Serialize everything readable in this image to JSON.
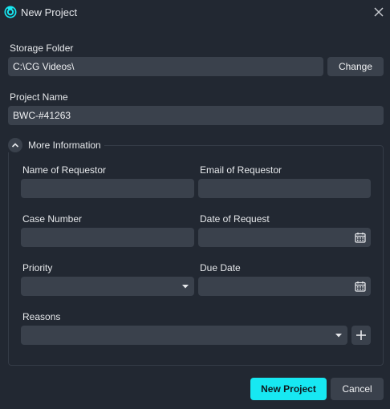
{
  "window": {
    "title": "New Project",
    "accent_color": "#17e8f2",
    "background_color": "#222832",
    "field_color": "#3a414c"
  },
  "storage": {
    "label": "Storage Folder",
    "value": "C:\\CG Videos\\",
    "change_label": "Change"
  },
  "project": {
    "label": "Project Name",
    "value": "BWC-#41263"
  },
  "more_info": {
    "title": "More Information",
    "expanded": true,
    "name_of_requestor": {
      "label": "Name of Requestor",
      "value": ""
    },
    "email_of_requestor": {
      "label": "Email of Requestor",
      "value": ""
    },
    "case_number": {
      "label": "Case Number",
      "value": ""
    },
    "date_of_request": {
      "label": "Date of Request",
      "value": "",
      "icon": "calendar-icon"
    },
    "priority": {
      "label": "Priority",
      "value": "",
      "icon": "chevron-down-icon"
    },
    "due_date": {
      "label": "Due Date",
      "value": "",
      "icon": "calendar-icon"
    },
    "reasons": {
      "label": "Reasons",
      "value": "",
      "icon": "chevron-down-icon",
      "add_icon": "plus-icon"
    }
  },
  "actions": {
    "primary_label": "New Project",
    "cancel_label": "Cancel"
  }
}
